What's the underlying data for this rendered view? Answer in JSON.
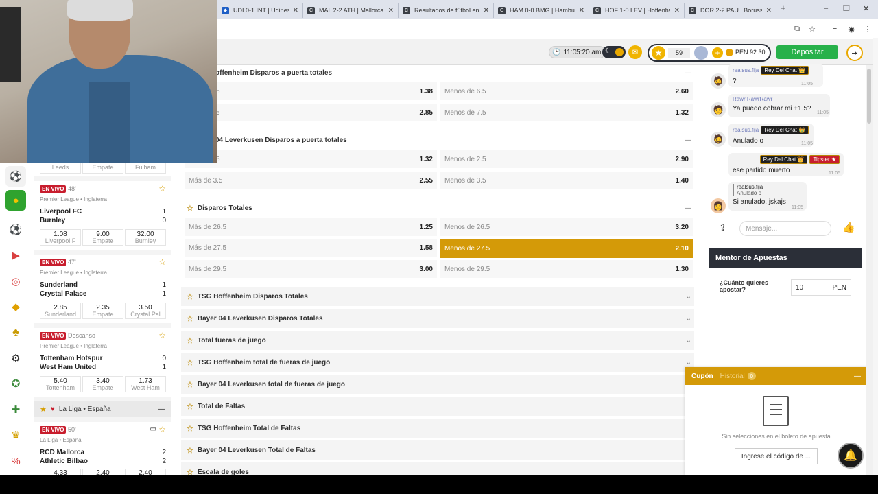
{
  "browser": {
    "tabs": [
      {
        "label": "UDI 0-1 INT | Udinese vs I",
        "fav": "b"
      },
      {
        "label": "MAL 2-2 ATH | Mallorca v",
        "fav": "C"
      },
      {
        "label": "Resultados de fútbol en v",
        "fav": "C"
      },
      {
        "label": "HAM 0-0 BMG | Hamburg",
        "fav": "C"
      },
      {
        "label": "HOF 1-0 LEV | Hoffenheim",
        "fav": "C"
      },
      {
        "label": "DOR 2-2 PAU | Borussia D",
        "fav": "C"
      }
    ],
    "new_tab": "+",
    "win_min": "–",
    "win_max": "❐",
    "win_close": "✕"
  },
  "header": {
    "time": "11:05:20 am",
    "points": "59",
    "balance": "PEN 92.30",
    "deposit_label": "Depositar"
  },
  "matches": [
    {
      "prev_teams": [
        "Leeds",
        "Empate",
        "Fulham"
      ]
    },
    {
      "live": "EN VIVO",
      "minute": "48'",
      "league": "Premier League • Inglaterra",
      "home": "Liverpool FC",
      "away": "Burnley",
      "home_score": "1",
      "away_score": "0",
      "odds": [
        {
          "v": "1.08",
          "n": "Liverpool F"
        },
        {
          "v": "9.00",
          "n": "Empate"
        },
        {
          "v": "32.00",
          "n": "Burnley"
        }
      ]
    },
    {
      "live": "EN VIVO",
      "minute": "47'",
      "league": "Premier League • Inglaterra",
      "home": "Sunderland",
      "away": "Crystal Palace",
      "home_score": "1",
      "away_score": "1",
      "odds": [
        {
          "v": "2.85",
          "n": "Sunderland"
        },
        {
          "v": "2.35",
          "n": "Empate"
        },
        {
          "v": "3.50",
          "n": "Crystal Pal"
        }
      ]
    },
    {
      "live": "EN VIVO",
      "minute": "Descanso",
      "league": "Premier League • Inglaterra",
      "home": "Tottenham Hotspur",
      "away": "West Ham United",
      "home_score": "0",
      "away_score": "1",
      "odds": [
        {
          "v": "5.40",
          "n": "Tottenham"
        },
        {
          "v": "3.40",
          "n": "Empate"
        },
        {
          "v": "1.73",
          "n": "West Ham"
        }
      ]
    },
    {
      "live": "EN VIVO",
      "minute": "50'",
      "league": "La Liga • España",
      "home": "RCD Mallorca",
      "away": "Athletic Bilbao",
      "home_score": "2",
      "away_score": "2",
      "odds": [
        {
          "v": "4.33",
          "n": ""
        },
        {
          "v": "2.40",
          "n": ""
        },
        {
          "v": "2.40",
          "n": ""
        }
      ]
    }
  ],
  "laliga_header": "La Liga • España",
  "markets": {
    "m1": {
      "title": "offenheim Disparos a puerta totales",
      "rows": [
        [
          "5",
          "1.38",
          "Menos de 6.5",
          "2.60"
        ],
        [
          "5",
          "2.85",
          "Menos de 7.5",
          "1.32"
        ]
      ]
    },
    "m2": {
      "title": "04 Leverkusen Disparos a puerta totales",
      "rows": [
        [
          "5",
          "1.32",
          "Menos de 2.5",
          "2.90"
        ],
        [
          "Más de 3.5",
          "2.55",
          "Menos de 3.5",
          "1.40"
        ]
      ]
    },
    "m3": {
      "title": "Disparos Totales",
      "rows": [
        [
          "Más de 26.5",
          "1.25",
          "Menos de 26.5",
          "3.20"
        ],
        [
          "Más de 27.5",
          "1.58",
          "Menos de 27.5",
          "2.10"
        ],
        [
          "Más de 29.5",
          "3.00",
          "Menos de 29.5",
          "1.30"
        ]
      ]
    },
    "collapsed": [
      "TSG Hoffenheim Disparos Totales",
      "Bayer 04 Leverkusen Disparos Totales",
      "Total fueras de juego",
      "TSG Hoffenheim total de fueras de juego",
      "Bayer 04 Leverkusen total de fueras de juego",
      "Total de Faltas",
      "TSG Hoffenheim Total de Faltas",
      "Bayer 04 Leverkusen Total de Faltas",
      "Escala de goles"
    ]
  },
  "chat": {
    "m1_user": "realsus.fija",
    "m1_badge": "Rey Del Chat 👑",
    "m1_text": "?",
    "m1_time": "11:05",
    "m2_user": "Rawr RawrRawr",
    "m2_text": "Ya puedo cobrar mi +1.5?",
    "m2_time": "11:05",
    "m3_user": "realsus.fija",
    "m3_badge": "Rey Del Chat 👑",
    "m3_text": "Anulado o",
    "m3_time": "11:05",
    "m4_badge1": "Rey Del Chat 👑",
    "m4_badge2": "Tipster ★",
    "m4_text": "ese partido muerto",
    "m4_time": "11:05",
    "m5_quote_user": "realsus.fija",
    "m5_quote_text": "Anulado o",
    "m5_text": "Si anulado, jskajs",
    "m5_time": "11:05",
    "placeholder": "Mensaje..."
  },
  "mentor": {
    "title": "Mentor de Apuestas",
    "question": "¿Cuánto quieres apostar?",
    "amount": "10",
    "currency": "PEN"
  },
  "coupon": {
    "tab_active": "Cupón",
    "tab_history": "Historial",
    "history_count": "0",
    "empty_text": "Sin selecciones en el boleto de apuesta",
    "code_button": "Ingrese el código de ...",
    "minimize": "—"
  }
}
